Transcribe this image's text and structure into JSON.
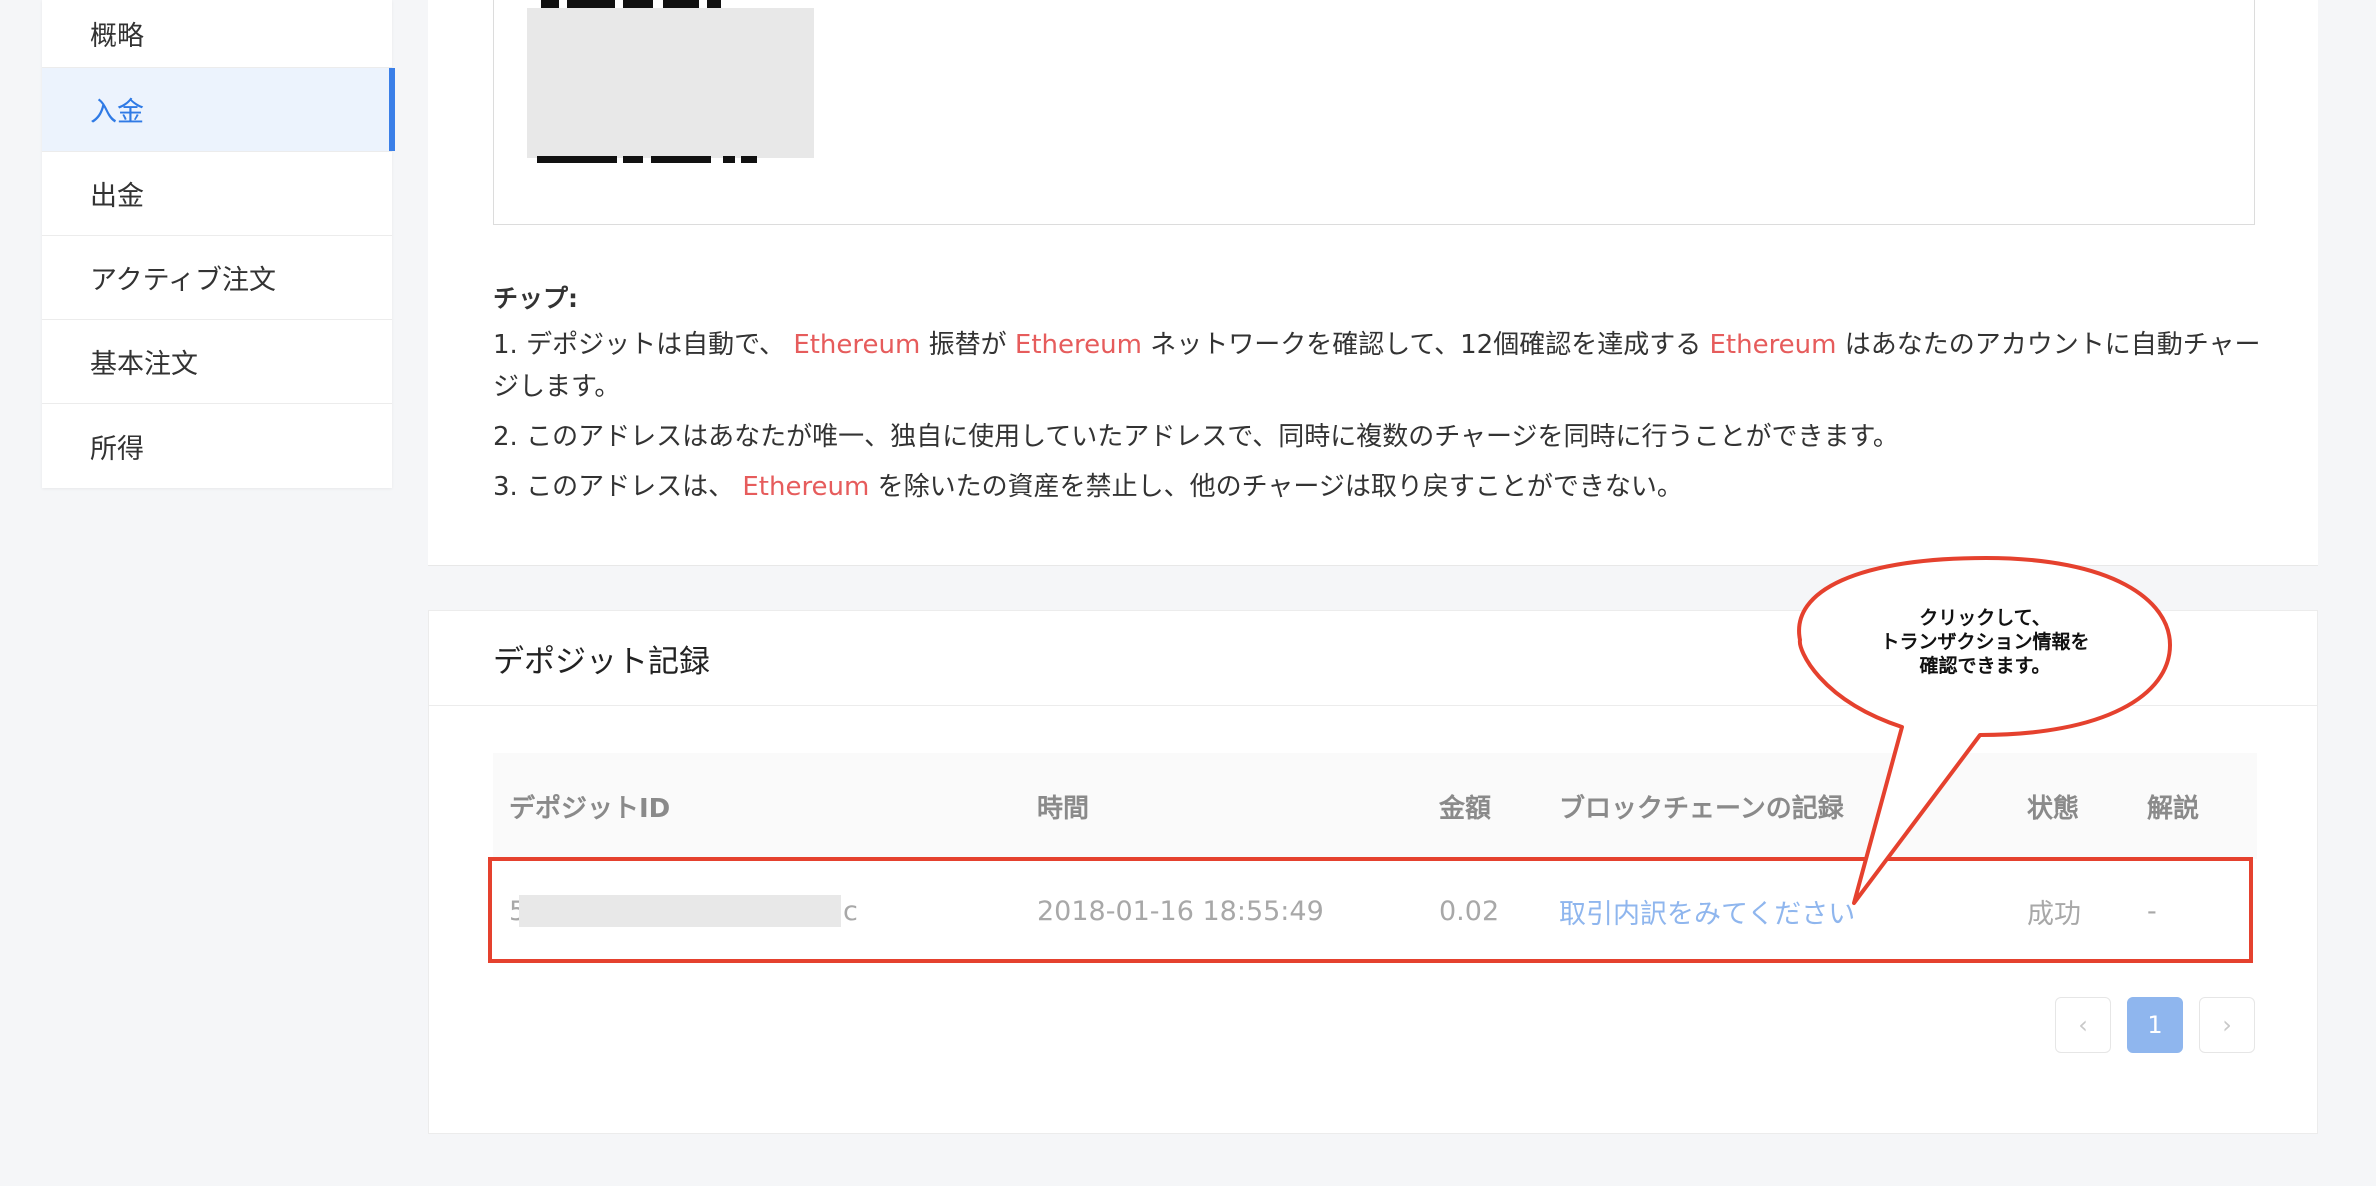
{
  "sidebar": {
    "items": [
      {
        "label": "概略"
      },
      {
        "label": "入金"
      },
      {
        "label": "出金"
      },
      {
        "label": "アクティブ注文"
      },
      {
        "label": "基本注文"
      },
      {
        "label": "所得"
      }
    ],
    "active_index": 1
  },
  "tips": {
    "title": "チップ:",
    "line1": {
      "p1": "1. デポジットは自動で、",
      "h1": "Ethereum",
      "p2": "振替が",
      "h2": "Ethereum",
      "p3": "ネットワークを確認して、12個確認を達成する",
      "h3": "Ethereum",
      "p4": "はあなたのアカウントに自動チャージします。"
    },
    "line2": "2. このアドレスはあなたが唯一、独自に使用していたアドレスで、同時に複数のチャージを同時に行うことができます。",
    "line3": {
      "p1": "3. このアドレスは、",
      "h1": "Ethereum",
      "p2": "を除いたの資産を禁止し、他のチャージは取り戻すことができない。"
    }
  },
  "records": {
    "title": "デポジット記録",
    "columns": {
      "id": "デポジットID",
      "time": "時間",
      "amount": "金額",
      "chain": "ブロックチェーンの記録",
      "state": "状態",
      "note": "解説"
    },
    "rows": [
      {
        "id_start": "5",
        "id_end": "c",
        "time": "2018-01-16 18:55:49",
        "amount": "0.02",
        "chain_link": "取引内訳をみてください",
        "state": "成功",
        "note": "-"
      }
    ],
    "pagination": {
      "prev": "‹",
      "current_page": "1",
      "next": "›"
    }
  },
  "callout": {
    "line1": "クリックして、",
    "line2": "トランザクション情報を",
    "line3": "確認できます。"
  },
  "colors": {
    "accent": "#3a7fe8",
    "highlight_red": "#e5412e",
    "ethereum_text": "#e65c5c",
    "link": "#8fb6ee"
  }
}
